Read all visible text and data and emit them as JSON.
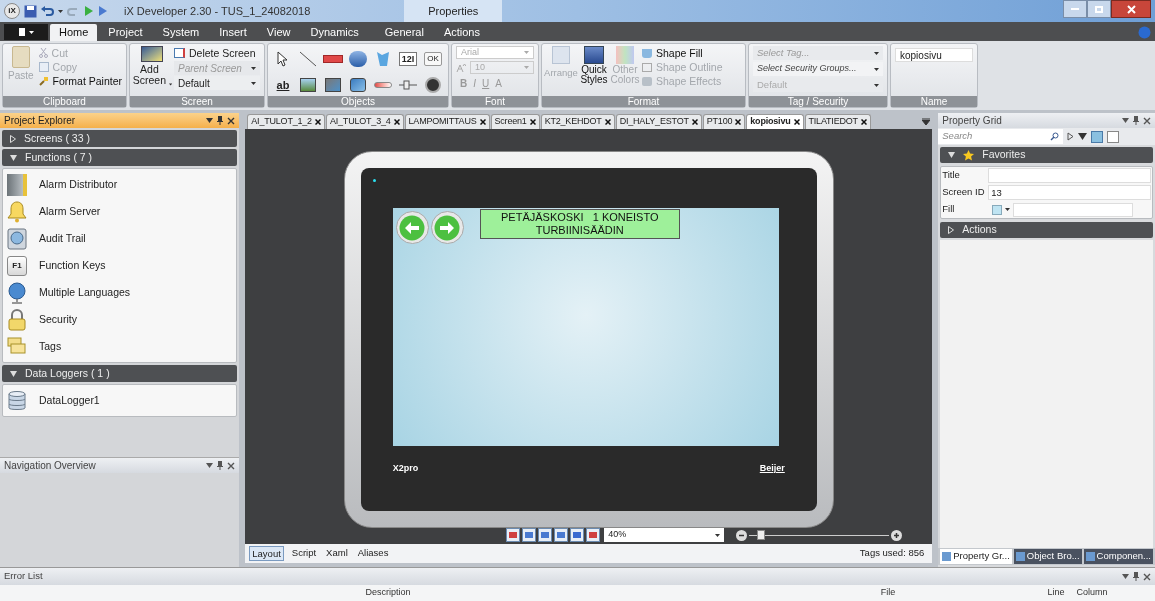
{
  "title_bar": {
    "logo": "iX",
    "title": "iX Developer 2.30 - TUS_1_24082018",
    "context_label": "Properties"
  },
  "ribbon_tabs": [
    {
      "label": "Home",
      "selected": true
    },
    {
      "label": "Project",
      "selected": false
    },
    {
      "label": "System",
      "selected": false
    },
    {
      "label": "Insert",
      "selected": false
    },
    {
      "label": "View",
      "selected": false
    },
    {
      "label": "Dynamics",
      "selected": false
    },
    {
      "label": "General",
      "selected": false
    },
    {
      "label": "Actions",
      "selected": false
    }
  ],
  "ribbon": {
    "clipboard": {
      "label": "Clipboard",
      "paste": {
        "label": "Paste",
        "disabled": true
      },
      "cut": {
        "label": "Cut",
        "disabled": true
      },
      "copy": {
        "label": "Copy",
        "disabled": true
      },
      "format_painter": {
        "label": "Format Painter",
        "disabled": false
      }
    },
    "screen": {
      "label": "Screen",
      "add_screen": {
        "label": "Add Screen"
      },
      "delete_screen": {
        "label": "Delete Screen"
      },
      "parent_screen": {
        "placeholder": "Parent Screen"
      },
      "style": {
        "value": "Default"
      }
    },
    "objects": {
      "label": "Objects",
      "tools": [
        {
          "kind": "pointer"
        },
        {
          "kind": "line"
        },
        {
          "kind": "rectangle"
        },
        {
          "kind": "ellipse"
        },
        {
          "kind": "polygon"
        },
        {
          "kind": "numeric",
          "text": "12I"
        },
        {
          "kind": "button",
          "text": "OK"
        },
        {
          "kind": "text",
          "text": "ab"
        },
        {
          "kind": "picture"
        },
        {
          "kind": "media"
        },
        {
          "kind": "video"
        },
        {
          "kind": "bar"
        },
        {
          "kind": "slider"
        },
        {
          "kind": "meter"
        }
      ]
    },
    "font": {
      "label": "Font",
      "family": {
        "value": "Arial"
      },
      "size": {
        "value": "10"
      },
      "styles": [
        "B",
        "I",
        "U",
        "A"
      ]
    },
    "format": {
      "label": "Format",
      "arrange": {
        "label": "Arrange",
        "disabled": true
      },
      "quick_styles": {
        "label": "Quick Styles",
        "disabled": false
      },
      "other_colors": {
        "label": "Other Colors",
        "disabled": true
      },
      "shape_fill": {
        "label": "Shape Fill",
        "disabled": false
      },
      "shape_outline": {
        "label": "Shape Outline",
        "disabled": true
      },
      "shape_effects": {
        "label": "Shape Effects",
        "disabled": true
      }
    },
    "tag_security": {
      "label": "Tag / Security",
      "tag": {
        "placeholder": "Select Tag...",
        "disabled": true
      },
      "groups": {
        "placeholder": "Select Security Groups...",
        "disabled": false
      },
      "default": {
        "value": "Default",
        "disabled": true
      }
    },
    "name": {
      "label": "Name",
      "value": "kopiosivu"
    }
  },
  "project_explorer": {
    "title": "Project Explorer",
    "sections": [
      {
        "label": "Screens ( 33 )",
        "expanded": false
      },
      {
        "label": "Functions ( 7 )",
        "expanded": true,
        "items": [
          {
            "kind": "server",
            "label": "Alarm Distributor"
          },
          {
            "kind": "bell",
            "label": "Alarm Server"
          },
          {
            "kind": "audit",
            "label": "Audit Trail"
          },
          {
            "kind": "key",
            "key_text": "F1",
            "label": "Function Keys"
          },
          {
            "kind": "globe",
            "label": "Multiple Languages"
          },
          {
            "kind": "lock",
            "label": "Security"
          },
          {
            "kind": "folders",
            "label": "Tags"
          }
        ]
      },
      {
        "label": "Data Loggers ( 1 )",
        "expanded": true,
        "items": [
          {
            "kind": "database",
            "label": "DataLogger1"
          }
        ]
      }
    ]
  },
  "navigation_overview": {
    "title": "Navigation Overview"
  },
  "document_tabs": [
    {
      "label": "AI_TULOT_1_2",
      "selected": false
    },
    {
      "label": "AI_TULOT_3_4",
      "selected": false
    },
    {
      "label": "LAMPOMITTAUS",
      "selected": false
    },
    {
      "label": "Screen1",
      "selected": false
    },
    {
      "label": "KT2_KEHDOT",
      "selected": false
    },
    {
      "label": "DI_HALY_ESTOT",
      "selected": false
    },
    {
      "label": "PT100",
      "selected": false
    },
    {
      "label": "kopiosivu",
      "selected": true
    },
    {
      "label": "TILATIEDOT",
      "selected": false
    }
  ],
  "device": {
    "model": "X2pro",
    "brand": "Beijer",
    "screen": {
      "title_lines": [
        "PETÄJÄSKOSKI   1 KONEISTO",
        "TURBIINISÄÄDIN"
      ]
    }
  },
  "zoom": {
    "value": "40%",
    "level": 0.06
  },
  "editor_tabs": [
    {
      "label": "Layout",
      "selected": true
    },
    {
      "label": "Script",
      "selected": false
    },
    {
      "label": "Xaml",
      "selected": false
    },
    {
      "label": "Aliases",
      "selected": false
    }
  ],
  "tags_used": "Tags used: 856",
  "property_grid": {
    "title": "Property Grid",
    "search_placeholder": "Search",
    "favorites": {
      "label": "Favorites",
      "expanded": true,
      "properties": [
        {
          "kind": "text",
          "name": "Title"
        },
        {
          "kind": "text",
          "name": "Screen ID",
          "value": "13"
        },
        {
          "kind": "color",
          "name": "Fill"
        }
      ]
    },
    "actions": {
      "label": "Actions",
      "expanded": false
    }
  },
  "right_tabs": [
    {
      "label": "Property Gr...",
      "selected": true
    },
    {
      "label": "Object Bro...",
      "selected": false
    },
    {
      "label": "Componen...",
      "selected": false
    }
  ],
  "error_list": {
    "title": "Error List",
    "columns": [
      "Description",
      "File",
      "Line",
      "Column"
    ]
  }
}
